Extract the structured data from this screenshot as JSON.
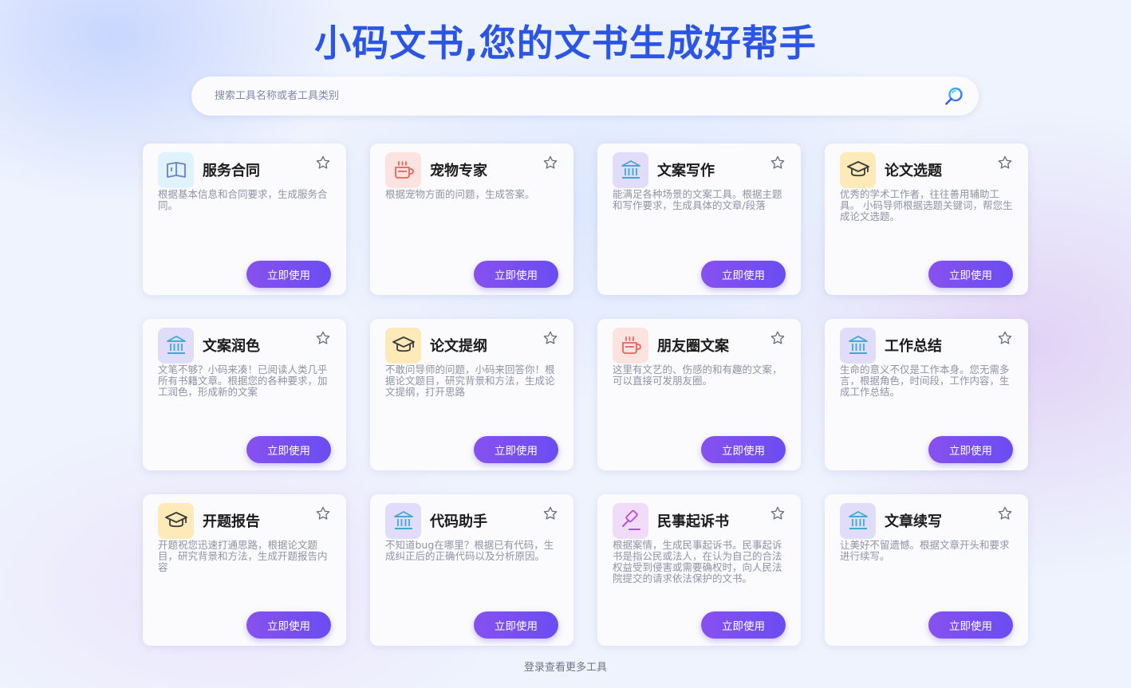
{
  "title": "小码文书,您的文书生成好帮手",
  "search": {
    "placeholder": "搜索工具名称或者工具类别"
  },
  "button_label": "立即使用",
  "more_link": "登录查看更多工具",
  "colors": {
    "title": "#2a55e6",
    "button": "#7b4ff1",
    "book_bg": "#e0f2fb",
    "cup_bg": "#fde3e0",
    "bank_bg": "#e0dcf9",
    "cap_bg": "#fdeab8",
    "gavel_bg": "#f0dcf8"
  },
  "tools": [
    {
      "icon": "book-icon",
      "title": "服务合同",
      "desc": "根据基本信息和合同要求，生成服务合同。"
    },
    {
      "icon": "coffee-cup-icon",
      "title": "宠物专家",
      "desc": "根据宠物方面的问题，生成答案。"
    },
    {
      "icon": "bank-icon",
      "title": "文案写作",
      "desc": "能满足各种场景的文案工具。根据主题和写作要求，生成具体的文章/段落"
    },
    {
      "icon": "graduation-cap-icon",
      "title": "论文选题",
      "desc": "优秀的学术工作者，往往善用辅助工具。 小码导师根据选题关键词，帮您生成论文选题。"
    },
    {
      "icon": "bank-icon",
      "title": "文案润色",
      "desc": "文笔不够？小码来凑！已阅读人类几乎所有书籍文章。根据您的各种要求，加工润色，形成新的文案"
    },
    {
      "icon": "graduation-cap-icon",
      "title": "论文提纲",
      "desc": "不敢问导师的问题，小码来回答你！根据论文题目，研究背景和方法，生成论文提纲，打开思路"
    },
    {
      "icon": "coffee-cup-icon",
      "title": "朋友圈文案",
      "desc": "这里有文艺的、伤感的和有趣的文案，可以直接可发朋友圈。"
    },
    {
      "icon": "bank-icon",
      "title": "工作总结",
      "desc": "生命的意义不仅是工作本身。您无需多言，根据角色，时间段，工作内容，生成工作总结。"
    },
    {
      "icon": "graduation-cap-icon",
      "title": "开题报告",
      "desc": "开题祝您迅速打通思路，根据论文题目，研究背景和方法，生成开题报告内容"
    },
    {
      "icon": "bank-icon",
      "title": "代码助手",
      "desc": "不知道bug在哪里？根据已有代码，生成纠正后的正确代码以及分析原因。"
    },
    {
      "icon": "gavel-icon",
      "title": "民事起诉书",
      "desc": "根据案情，生成民事起诉书。民事起诉书是指公民或法人，在认为自己的合法权益受到侵害或需要确权时，向人民法院提交的请求依法保护的文书。"
    },
    {
      "icon": "bank-icon",
      "title": "文章续写",
      "desc": "让美好不留遗憾。根据文章开头和要求进行续写。"
    }
  ]
}
